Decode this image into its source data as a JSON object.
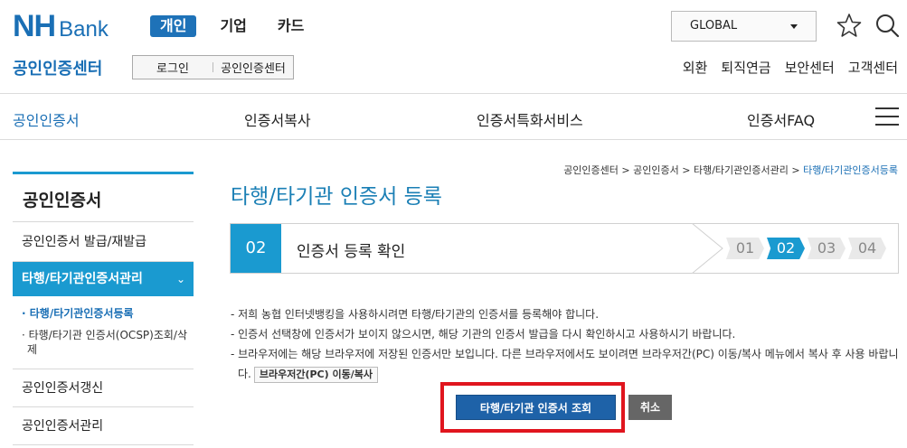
{
  "header": {
    "logo_nh": "NH",
    "logo_bank": "Bank",
    "nav": [
      {
        "label": "개인",
        "active": true
      },
      {
        "label": "기업",
        "active": false
      },
      {
        "label": "카드",
        "active": false
      }
    ],
    "global_select": "GLOBAL",
    "site_title": "공인인증센터",
    "login_links": [
      "로그인",
      "공인인증센터"
    ],
    "util_links": [
      "외환",
      "퇴직연금",
      "보안센터",
      "고객센터"
    ]
  },
  "menu": [
    "공인인증서",
    "인증서복사",
    "인증서특화서비스",
    "인증서FAQ"
  ],
  "sidebar": {
    "title": "공인인증서",
    "items": [
      "공인인증서 발급/재발급",
      "타행/타기관인증서관리",
      "공인인증서갱신",
      "공인인증서관리"
    ],
    "active_chevron": "⌄",
    "sub_items": [
      "· 타행/타기관인증서등록",
      "· 타행/타기관 인증서(OCSP)조회/삭제"
    ]
  },
  "breadcrumb": {
    "items": [
      "공인인증센터",
      "공인인증서",
      "타행/타기관인증서관리"
    ],
    "current": "타행/타기관인증서등록",
    "separator": " > "
  },
  "page_title": "타행/타기관 인증서 등록",
  "step": {
    "badge": "02",
    "label": "인증서 등록 확인",
    "steps": [
      "01",
      "02",
      "03",
      "04"
    ],
    "current_index": 1
  },
  "notes": [
    "- 저희 농협 인터넷뱅킹을 사용하시려면 타행/타기관의 인증서를 등록해야 합니다.",
    "- 인증서 선택창에 인증서가 보이지 않으시면, 해당 기관의 인증서 발급을 다시 확인하시고 사용하시기 바랍니다.",
    "- 브라우저에는 해당 브라우저에 저장된 인증서만 보입니다. 다른 브라우저에서도 보이려면 브라우저간(PC) 이동/복사 메뉴에서 복사 후 사용 바랍니다."
  ],
  "inline_button": "브라우저간(PC) 이동/복사",
  "buttons": {
    "query": "타행/타기관 인증서 조회",
    "cancel": "취소"
  },
  "colors": {
    "brand": "#1a6fb5",
    "accent": "#1a9ad0",
    "highlight": "#e0151e"
  }
}
